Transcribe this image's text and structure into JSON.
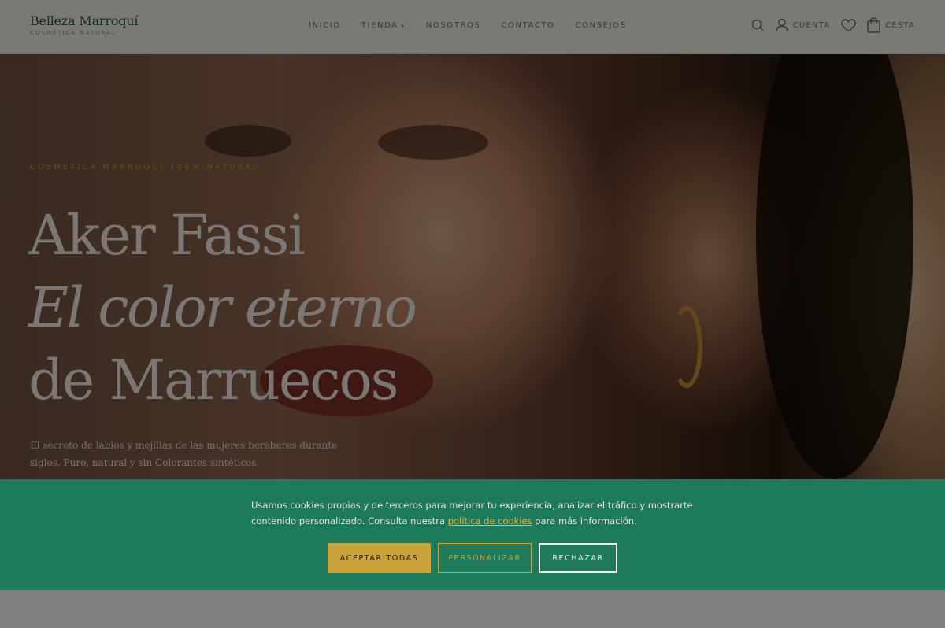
{
  "header": {
    "logo_name": "Belleza Marroquí",
    "logo_tagline": "COSMÉTICA NATURAL",
    "nav": [
      {
        "label": "INICIO"
      },
      {
        "label": "TIENDA"
      },
      {
        "label": "NOSOTROS"
      },
      {
        "label": "CONTACTO"
      },
      {
        "label": "CONSEJOS"
      }
    ],
    "account_label": "CUENTA",
    "cart_label": "CESTA"
  },
  "hero": {
    "kicker": "COSMÉTICA MARROQUÍ 100% NATURAL",
    "title_line1": "Aker Fassi",
    "title_line2": "El color eterno",
    "title_line3": "de Marruecos",
    "subtitle": "El secreto de labios y mejillas de las mujeres bereberes durante siglos. Puro, natural y sin Colorantes sintéticos."
  },
  "cookie": {
    "text_before": "Usamos cookies propias y de terceros para mejorar tu experiencia, analizar el tráfico y mostrarte contenido personalizado. Consulta nuestra ",
    "link_text": "política de cookies",
    "text_after": " para más información.",
    "accept_label": "ACEPTAR TODAS",
    "customize_label": "PERSONALIZAR",
    "reject_label": "RECHAZAR"
  },
  "colors": {
    "banner_green": "#1d7a5a",
    "gold_accent": "#c9a33a",
    "brand_green": "#1f5a45"
  }
}
